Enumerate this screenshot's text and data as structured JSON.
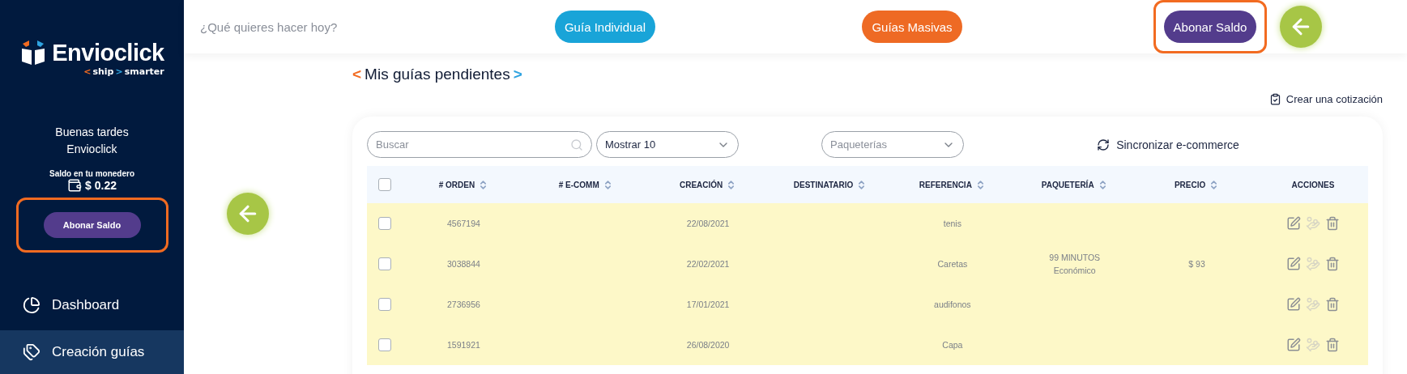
{
  "sidebar": {
    "logo": {
      "name": "Envioclick",
      "tagline": [
        {
          "text": "<",
          "color": "#f26b21"
        },
        {
          "text": "ship",
          "color": "#ffffff"
        },
        {
          "text": ">",
          "color": "#2fa3e0"
        },
        {
          "text": "smarter",
          "color": "#ffffff"
        }
      ]
    },
    "greeting": [
      "Buenas tardes",
      "Envioclick"
    ],
    "wallet": {
      "label": "Saldo en tu monedero",
      "amount": "$ 0.22",
      "button": {
        "label": "Abonar Saldo",
        "highlighted": true
      }
    },
    "items": [
      {
        "label": "Dashboard",
        "kind": "dashboard",
        "selected": false
      },
      {
        "label": "Creación guías",
        "kind": "labels",
        "selected": true
      }
    ]
  },
  "header": {
    "prompt": "¿Qué quieres hacer hoy?",
    "actions": [
      {
        "label": "Guía Individual",
        "color": "#19a4d8",
        "highlighted": false
      },
      {
        "label": "Guías Masivas",
        "color": "#ee6a24",
        "highlighted": false
      },
      {
        "label": "Abonar Saldo",
        "color": "#533c8c",
        "highlighted": true
      }
    ]
  },
  "page": {
    "title": [
      {
        "text": "<",
        "color": "#f26b21"
      },
      {
        "text": "Mis guías pendientes",
        "color": "#0f1a33"
      },
      {
        "text": ">",
        "color": "#2fa3e0"
      }
    ],
    "quote_link": "Crear una cotización",
    "search": {
      "placeholder": "Buscar"
    },
    "page_size": {
      "value": "Mostrar 10"
    },
    "carrier_filter": {
      "placeholder": "Paqueterías"
    },
    "sync": "Sincronizar e-commerce",
    "table": {
      "select_all": {
        "checked": false
      },
      "columns": [
        {
          "label": "# ORDEN",
          "sortable": true
        },
        {
          "label": "# E-COMM",
          "sortable": true
        },
        {
          "label": "CREACIÓN",
          "sortable": true
        },
        {
          "label": "DESTINATARIO",
          "sortable": true
        },
        {
          "label": "REFERENCIA",
          "sortable": true
        },
        {
          "label": "PAQUETERÍA",
          "sortable": true
        },
        {
          "label": "PRECIO",
          "sortable": true
        },
        {
          "label": "ACCIONES",
          "sortable": false
        }
      ],
      "rows": [
        {
          "checked": false,
          "cells": [
            "4567194",
            "",
            "22/08/2021",
            "",
            "tenis",
            [],
            ""
          ],
          "pay_disabled": true
        },
        {
          "checked": false,
          "cells": [
            "3038844",
            "",
            "22/02/2021",
            "",
            "Caretas",
            [
              "99 MINUTOS",
              "Económico"
            ],
            "$ 93"
          ],
          "pay_disabled": true
        },
        {
          "checked": false,
          "cells": [
            "2736956",
            "",
            "17/01/2021",
            "",
            "audifonos",
            [],
            ""
          ],
          "pay_disabled": true
        },
        {
          "checked": false,
          "cells": [
            "1591921",
            "",
            "26/08/2020",
            "",
            "Capa",
            [],
            ""
          ],
          "pay_disabled": true
        }
      ]
    }
  }
}
